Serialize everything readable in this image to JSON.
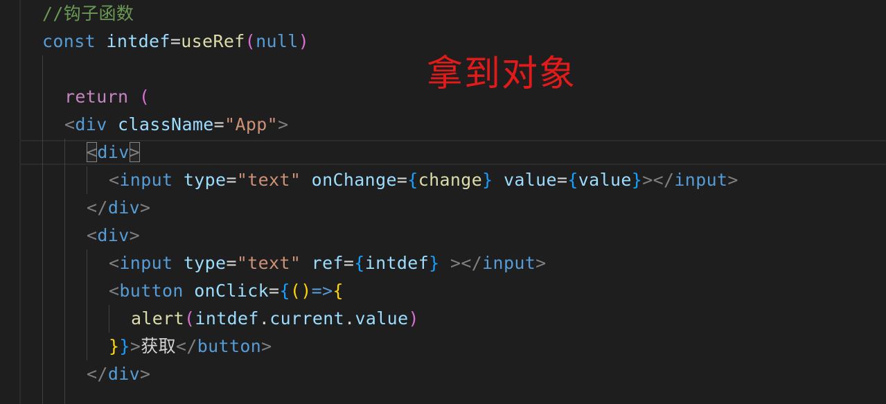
{
  "editor": {
    "annotation_text": "拿到对象",
    "lines": {
      "l1": {
        "comment": "//钩子函数"
      },
      "l2": {
        "kw": "const",
        "name": "intdef",
        "eq": "=",
        "fn": "useRef",
        "lp": "(",
        "arg": "null",
        "rp": ")"
      },
      "l4": {
        "kw": "return",
        "paren": "("
      },
      "l5": {
        "lt": "<",
        "tag": "div",
        "attr": "className",
        "eq": "=",
        "val": "\"App\"",
        "gt": ">"
      },
      "l6": {
        "lt": "<",
        "tag": "div",
        "gt": ">"
      },
      "l7": {
        "lt": "<",
        "tag": "input",
        "attr1": "type",
        "eq1": "=",
        "val1": "\"text\"",
        "attr2": "onChange",
        "eq2": "=",
        "ob1": "{",
        "expr1": "change",
        "cb1": "}",
        "attr3": "value",
        "eq3": "=",
        "ob2": "{",
        "expr2": "value",
        "cb2": "}",
        "gt": ">",
        "close_open": "</",
        "close_tag": "input",
        "close_gt": ">"
      },
      "l8": {
        "open": "</",
        "tag": "div",
        "gt": ">"
      },
      "l9": {
        "lt": "<",
        "tag": "div",
        "gt": ">"
      },
      "l10": {
        "lt": "<",
        "tag": "input",
        "attr1": "type",
        "eq1": "=",
        "val1": "\"text\"",
        "attr2": "ref",
        "eq2": "=",
        "ob": "{",
        "expr": "intdef",
        "cb": "}",
        "gt": ">",
        "close_open": "</",
        "close_tag": "input",
        "close_gt": ">"
      },
      "l11": {
        "lt": "<",
        "tag": "button",
        "attr": "onClick",
        "eq": "=",
        "ob": "{",
        "lp": "(",
        "rp": ")",
        "arrow": "=>",
        "ob2": "{"
      },
      "l12": {
        "fn": "alert",
        "lp": "(",
        "obj": "intdef",
        "dot1": ".",
        "prop1": "current",
        "dot2": ".",
        "prop2": "value",
        "rp": ")"
      },
      "l13": {
        "cb2": "}",
        "cb": "}",
        "gt": ">",
        "text": "获取",
        "close_open": "</",
        "close_tag": "button",
        "close_gt": ">"
      },
      "l14": {
        "open": "</",
        "tag": "div",
        "gt": ">"
      }
    }
  }
}
